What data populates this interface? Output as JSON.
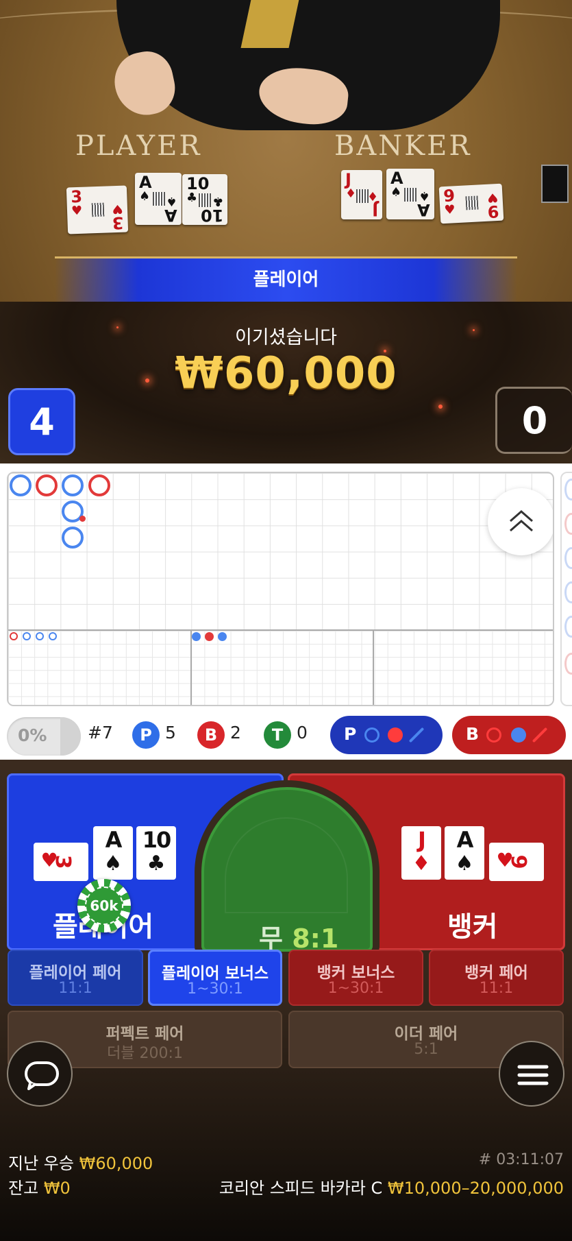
{
  "video": {
    "felt_player": "PLAYER",
    "felt_banker": "BANKER",
    "player_cards": [
      {
        "rank": "3",
        "suit": "♥",
        "color": "red"
      },
      {
        "rank": "A",
        "suit": "♠",
        "color": "black"
      },
      {
        "rank": "10",
        "suit": "♣",
        "color": "black"
      }
    ],
    "banker_cards": [
      {
        "rank": "J",
        "suit": "♦",
        "color": "red"
      },
      {
        "rank": "A",
        "suit": "♠",
        "color": "black"
      },
      {
        "rank": "9",
        "suit": "♥",
        "color": "red"
      }
    ]
  },
  "result": {
    "banner": "플레이어",
    "win_text": "이기셨습니다",
    "win_amount": "₩60,000",
    "player_score": "4",
    "banker_score": "0"
  },
  "stats": {
    "percent": "0%",
    "shoe_round": "#7",
    "player_letter": "P",
    "player_count": "5",
    "banker_letter": "B",
    "banker_count": "2",
    "tie_letter": "T",
    "tie_count": "0",
    "predict_player": "P",
    "predict_banker": "B"
  },
  "bets": {
    "player_label": "플레이어",
    "tie_label": "무",
    "tie_odds": "8:1",
    "banker_label": "뱅커",
    "chip": "60k",
    "side": [
      {
        "name": "플레이어 페어",
        "odds": "11:1"
      },
      {
        "name": "플레이어 보너스",
        "odds": "1~30:1"
      },
      {
        "name": "뱅커 보너스",
        "odds": "1~30:1"
      },
      {
        "name": "뱅커 페어",
        "odds": "11:1"
      },
      {
        "name": "퍼펙트 페어",
        "odds": "더블 200:1"
      },
      {
        "name": "이더 페어",
        "odds": "5:1"
      }
    ]
  },
  "footer": {
    "last_win_label": "지난 우승",
    "last_win_value": "₩60,000",
    "balance_label": "잔고",
    "balance_value": "₩0",
    "table_name": "코리안 스피드 바카라 C",
    "limits": "₩10,000–20,000,000",
    "round_id": "# 03:11:07"
  },
  "colors": {
    "player": "#1d3ee0",
    "banker": "#b01e1e",
    "tie": "#2e7d2d",
    "gold": "#f0c33b"
  }
}
